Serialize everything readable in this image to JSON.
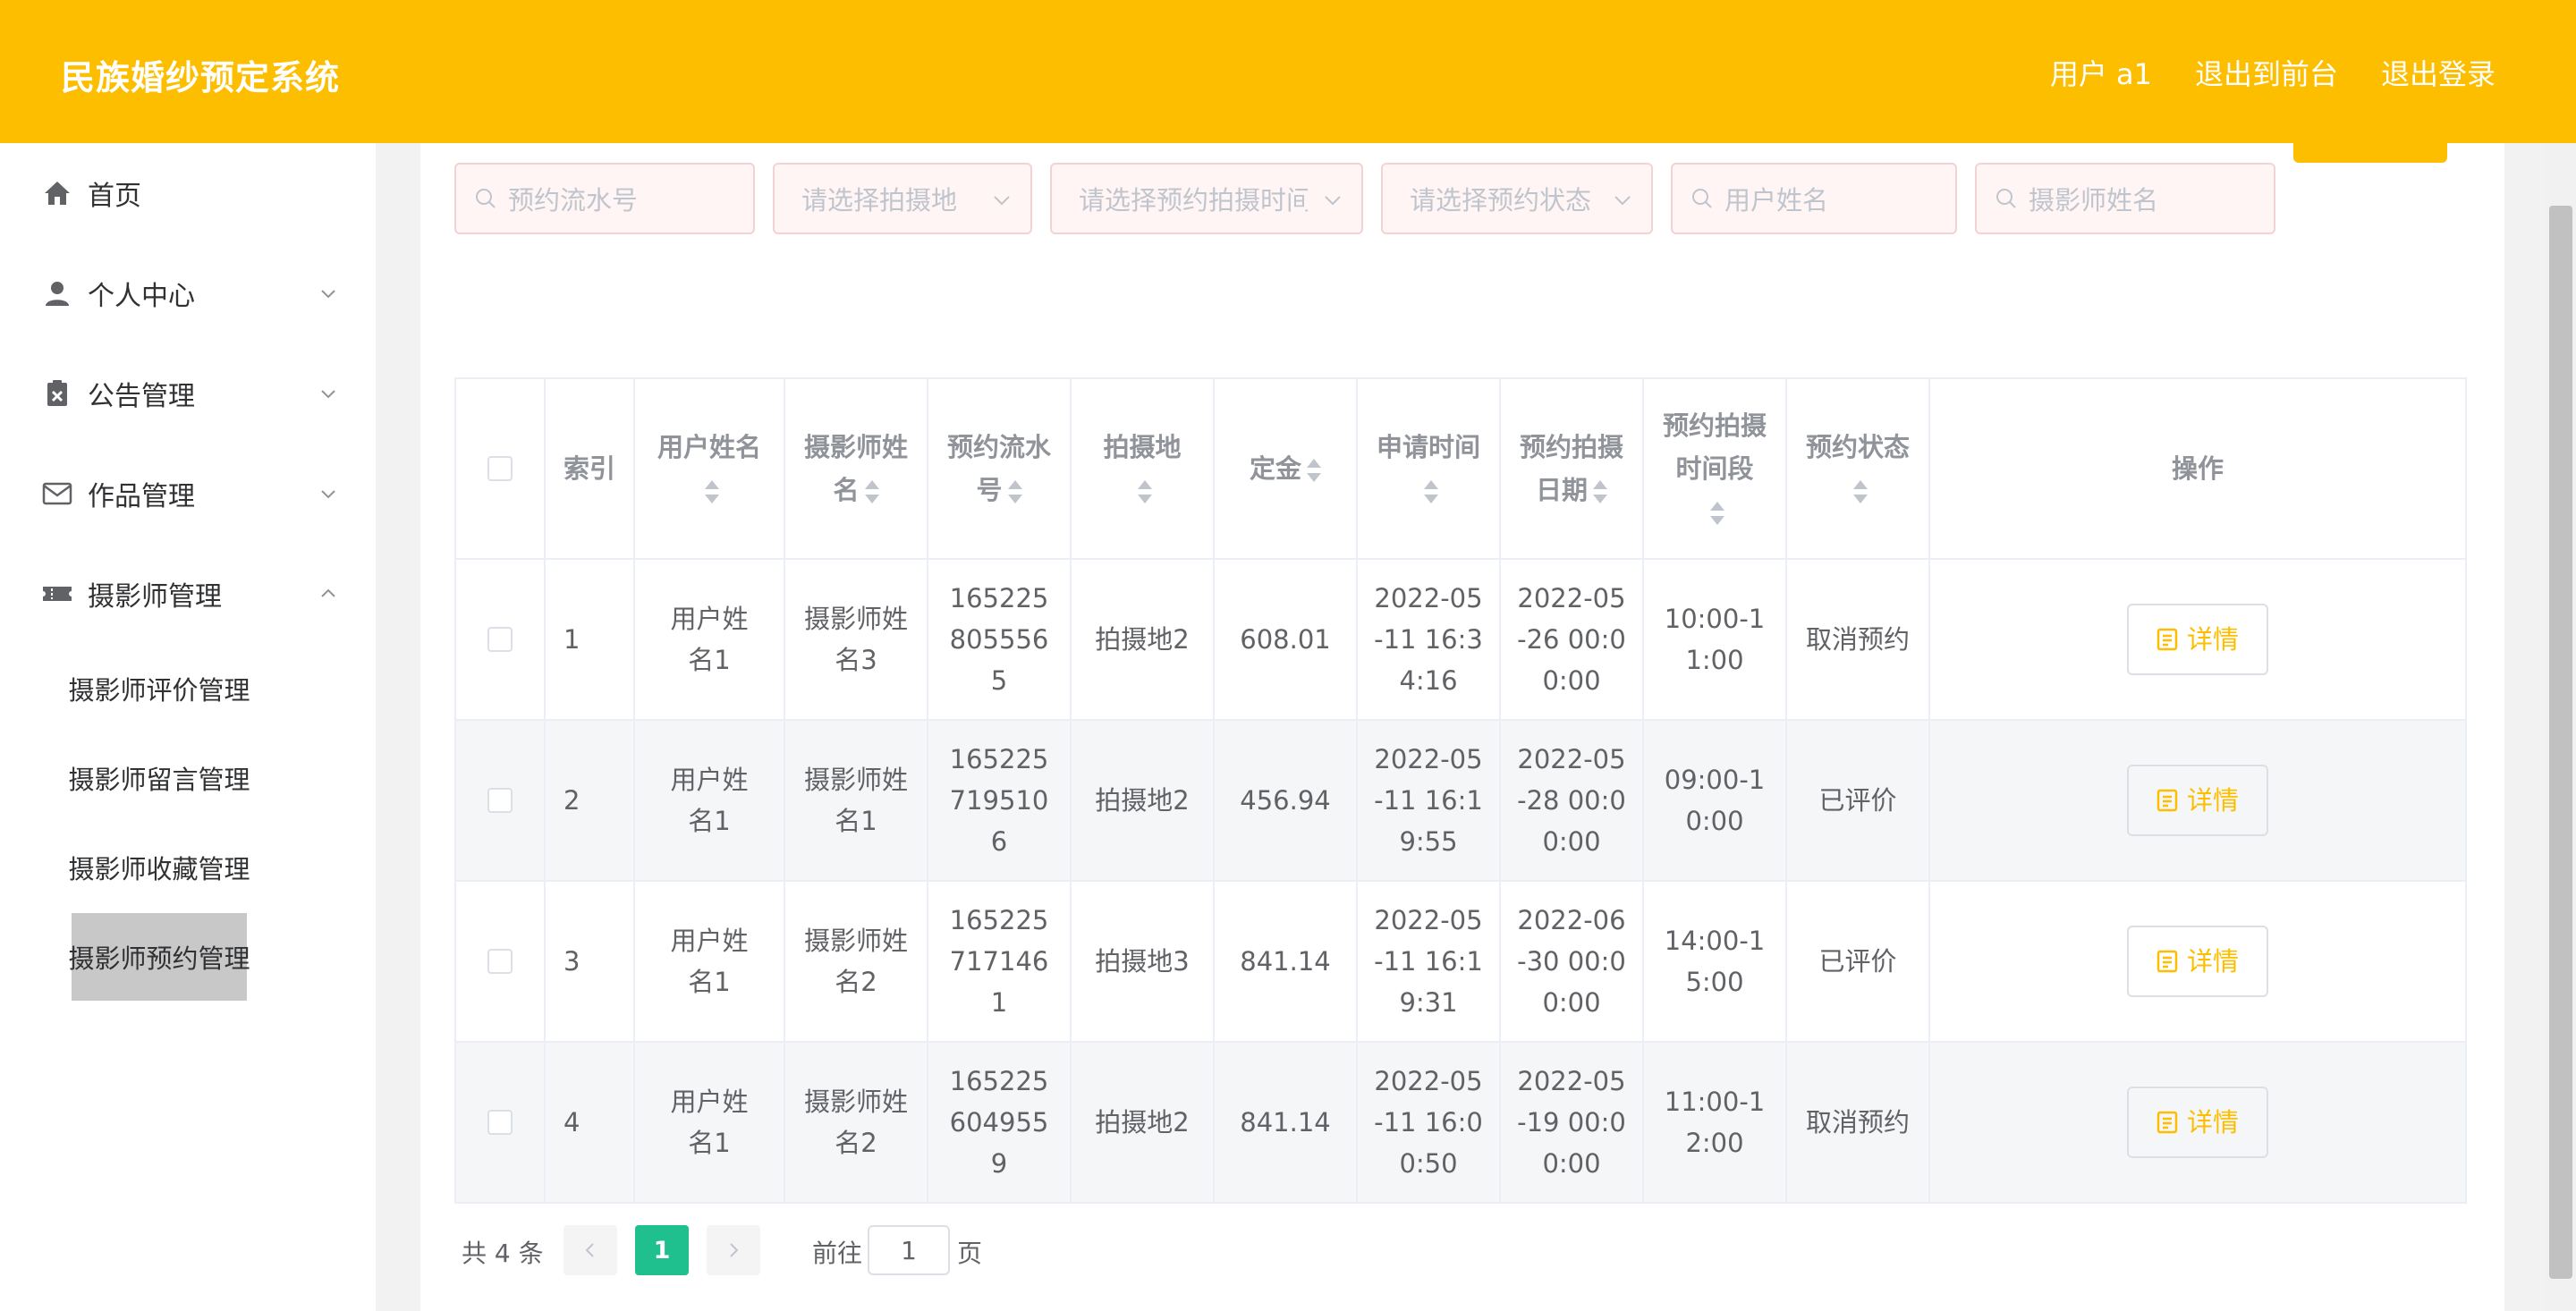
{
  "header": {
    "title": "民族婚纱预定系统",
    "user_label": "用户 a1",
    "to_front_label": "退出到前台",
    "logout_label": "退出登录"
  },
  "sidebar": {
    "items": [
      {
        "label": "首页",
        "icon": "home-icon"
      },
      {
        "label": "个人中心",
        "icon": "user-icon"
      },
      {
        "label": "公告管理",
        "icon": "clipboard-icon"
      },
      {
        "label": "作品管理",
        "icon": "mail-icon"
      },
      {
        "label": "摄影师管理",
        "icon": "ticket-icon"
      }
    ],
    "sub_items": [
      {
        "label": "摄影师评价管理"
      },
      {
        "label": "摄影师留言管理"
      },
      {
        "label": "摄影师收藏管理"
      },
      {
        "label": "摄影师预约管理"
      }
    ]
  },
  "search": {
    "serial_placeholder": "预约流水号",
    "location_placeholder": "请选择拍摄地",
    "time_placeholder": "请选择预约拍摄时间段",
    "status_placeholder": "请选择预约状态",
    "username_placeholder": "用户姓名",
    "photographer_placeholder": "摄影师姓名"
  },
  "table": {
    "headers": {
      "index": "索引",
      "username": "用户姓名",
      "photographer": "摄影师姓名",
      "serial": "预约流水号",
      "location": "拍摄地",
      "deposit": "定金",
      "apply_time": "申请时间",
      "shoot_date": "预约拍摄日期",
      "time_slot": "预约拍摄时间段",
      "status": "预约状态",
      "action": "操作"
    },
    "rows": [
      {
        "index": "1",
        "username": "用户姓名1",
        "photographer": "摄影师姓名3",
        "serial": "1652258055565",
        "location": "拍摄地2",
        "deposit": "608.01",
        "apply_time": "2022-05-11 16:34:16",
        "shoot_date": "2022-05-26 00:00:00",
        "time_slot": "10:00-11:00",
        "status": "取消预约",
        "action": "详情"
      },
      {
        "index": "2",
        "username": "用户姓名1",
        "photographer": "摄影师姓名1",
        "serial": "1652257195106",
        "location": "拍摄地2",
        "deposit": "456.94",
        "apply_time": "2022-05-11 16:19:55",
        "shoot_date": "2022-05-28 00:00:00",
        "time_slot": "09:00-10:00",
        "status": "已评价",
        "action": "详情"
      },
      {
        "index": "3",
        "username": "用户姓名1",
        "photographer": "摄影师姓名2",
        "serial": "1652257171461",
        "location": "拍摄地3",
        "deposit": "841.14",
        "apply_time": "2022-05-11 16:19:31",
        "shoot_date": "2022-06-30 00:00:00",
        "time_slot": "14:00-15:00",
        "status": "已评价",
        "action": "详情"
      },
      {
        "index": "4",
        "username": "用户姓名1",
        "photographer": "摄影师姓名2",
        "serial": "1652256049559",
        "location": "拍摄地2",
        "deposit": "841.14",
        "apply_time": "2022-05-11 16:00:50",
        "shoot_date": "2022-05-19 00:00:00",
        "time_slot": "11:00-12:00",
        "status": "取消预约",
        "action": "详情"
      }
    ]
  },
  "pagination": {
    "total_label": "共 4 条",
    "current_page": "1",
    "goto_label": "前往",
    "goto_value": "1",
    "page_suffix": "页"
  },
  "colors": {
    "header_bg": "#fdbe00",
    "accent": "#fdbe00",
    "page_active": "#1fc08e",
    "sidebar_active": "#c8c8c8"
  }
}
